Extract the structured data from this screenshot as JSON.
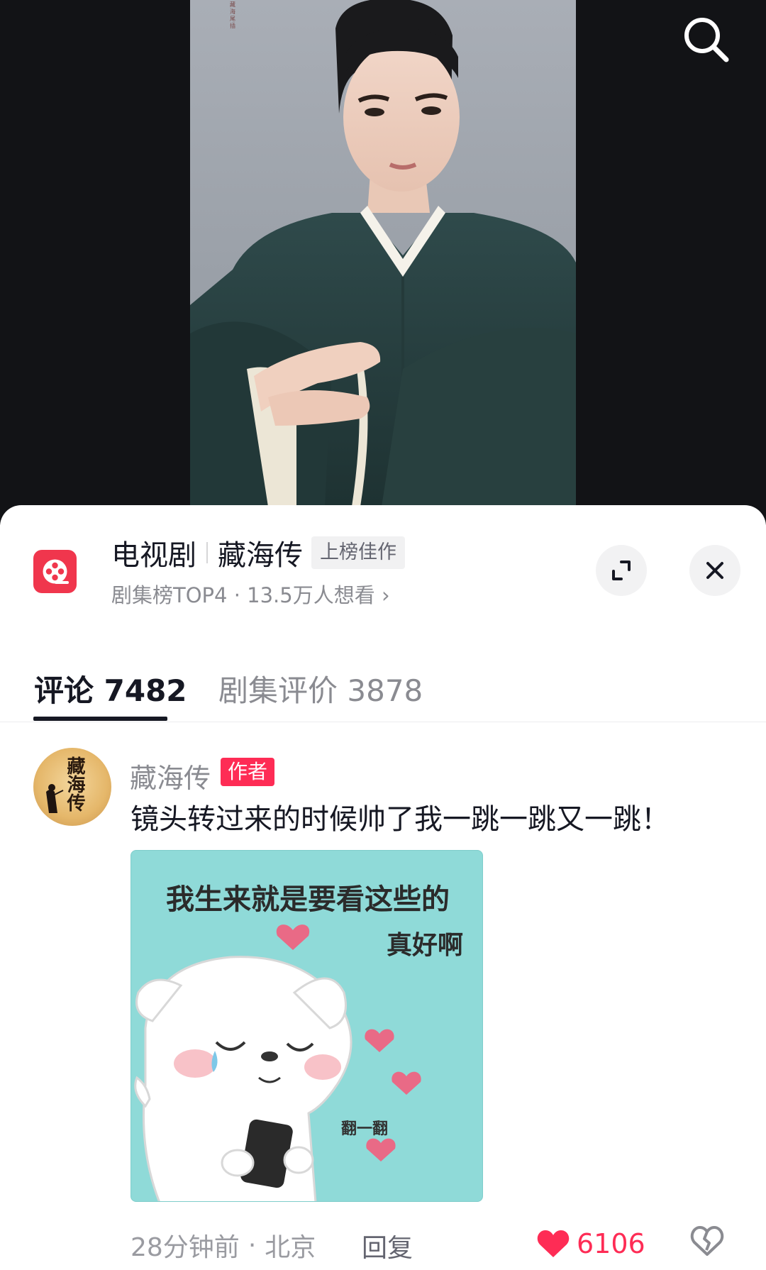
{
  "video": {
    "watermark": "藏海尾插"
  },
  "show": {
    "category": "电视剧",
    "name": "藏海传",
    "badge": "上榜佳作",
    "subtitle": "剧集榜TOP4 · 13.5万人想看",
    "chevron": "›"
  },
  "tabs": {
    "comments_label": "评论",
    "comments_count": "7482",
    "reviews_label": "剧集评价",
    "reviews_count": "3878"
  },
  "comment": {
    "avatar_text": "藏海传",
    "author": "藏海传",
    "author_tag": "作者",
    "text": "镜头转过来的时候帅了我一跳一跳又一跳！",
    "sticker": {
      "line1": "我生来就是要看这些的",
      "line2": "真好啊",
      "flip_label": "翻一翻"
    },
    "time": "28分钟前",
    "separator": "·",
    "location": "北京",
    "reply_label": "回复",
    "like_count": "6106"
  },
  "colors": {
    "accent": "#fe2c55",
    "show_icon_bg": "#f0364d",
    "text_primary": "#161823",
    "text_secondary": "#8a8b91"
  },
  "icons": {
    "search": "search-icon",
    "show": "film-reel-icon",
    "expand": "expand-icon",
    "close": "close-icon",
    "like": "heart-icon",
    "dislike": "broken-heart-icon",
    "chevron": "chevron-right-icon"
  }
}
